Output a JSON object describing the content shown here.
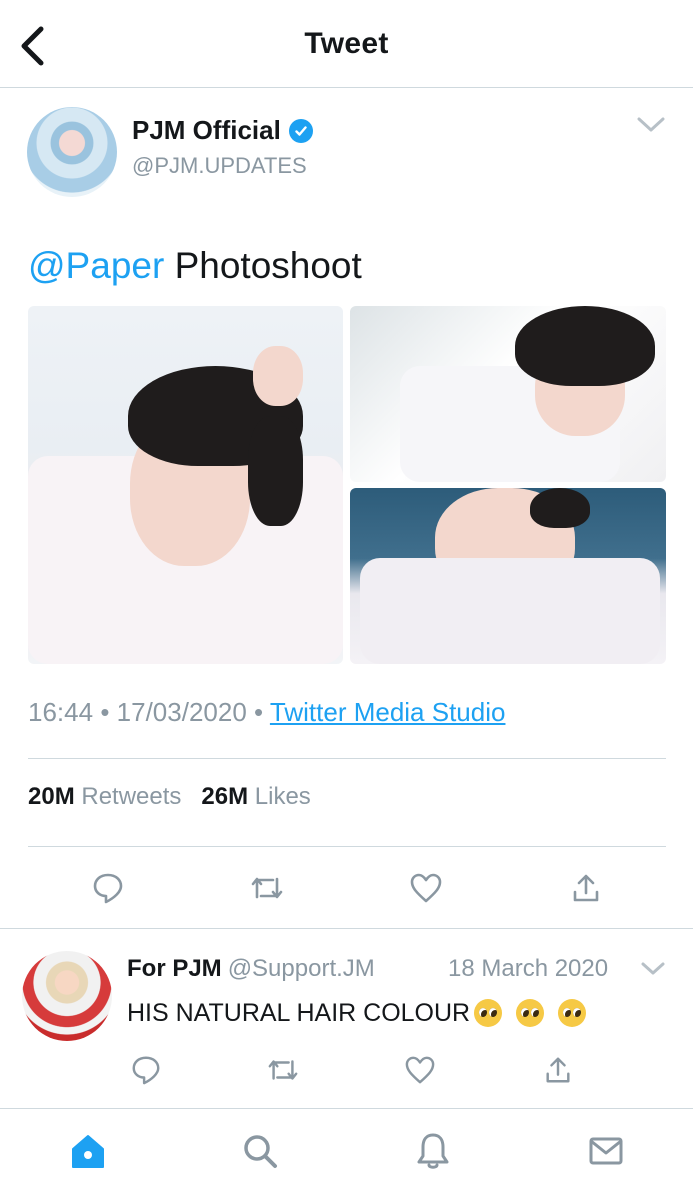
{
  "header": {
    "title": "Tweet",
    "back_icon": "back-chevron-icon"
  },
  "tweet": {
    "author_name": "PJM Official",
    "author_handle": "@PJM.UPDATES",
    "verified": true,
    "text_mention": "@Paper",
    "text_body": " Photoshoot",
    "time": "16:44",
    "date": "17/03/2020",
    "separator": "•",
    "source": "Twitter Media Studio",
    "retweets_count": "20M",
    "retweets_label": "Retweets",
    "likes_count": "26M",
    "likes_label": "Likes",
    "media_count": 3,
    "actions": [
      "reply-icon",
      "retweet-icon",
      "like-icon",
      "share-icon"
    ]
  },
  "reply": {
    "name": "For PJM",
    "handle": "@Support.JM",
    "date": "18 March 2020",
    "text": "HIS NATURAL HAIR COLOUR",
    "emoji_count": 3,
    "actions": [
      "reply-icon",
      "retweet-icon",
      "like-icon",
      "share-icon"
    ]
  },
  "tabbar": {
    "items": [
      "home-icon",
      "search-icon",
      "notifications-icon",
      "messages-icon"
    ]
  },
  "colors": {
    "accent": "#1da1f2",
    "text": "#14171a",
    "muted": "#8a97a1",
    "divider": "#cfd9de"
  }
}
